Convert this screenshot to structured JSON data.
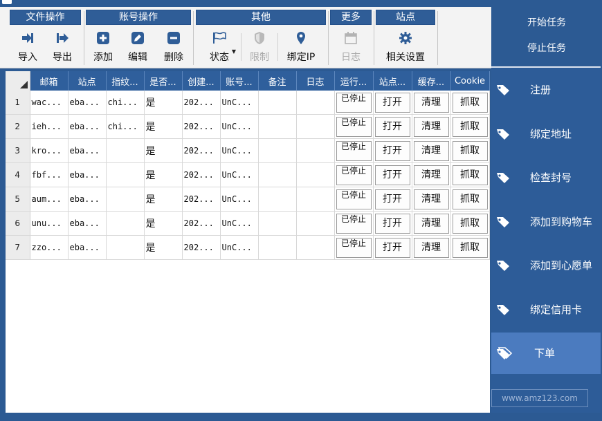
{
  "ribbon": {
    "groups": [
      {
        "title": "文件操作",
        "buttons": [
          {
            "label": "导入",
            "icon": "import-icon"
          },
          {
            "label": "导出",
            "icon": "export-icon"
          }
        ]
      },
      {
        "title": "账号操作",
        "buttons": [
          {
            "label": "添加",
            "icon": "plus-icon"
          },
          {
            "label": "编辑",
            "icon": "pencil-icon"
          },
          {
            "label": "删除",
            "icon": "minus-icon"
          }
        ]
      },
      {
        "title": "其他",
        "buttons": [
          {
            "label": "状态",
            "icon": "flag-icon"
          },
          {
            "label": "限制",
            "icon": "shield-icon"
          },
          {
            "label": "绑定IP",
            "icon": "location-pin-icon"
          }
        ]
      },
      {
        "title": "更多",
        "buttons": [
          {
            "label": "日志",
            "icon": "calendar-icon"
          }
        ]
      },
      {
        "title": "站点",
        "buttons": [
          {
            "label": "相关设置",
            "icon": "gear-icon"
          }
        ]
      }
    ]
  },
  "grid": {
    "columns": [
      "邮箱",
      "站点",
      "指纹...",
      "是否...",
      "创建...",
      "账号...",
      "备注",
      "日志",
      "运行...",
      "站点...",
      "缓存...",
      "Cookie"
    ],
    "rows": [
      {
        "num": "1",
        "email": "wac...",
        "site": "eba...",
        "fingerprint": "chi...",
        "flag": "是",
        "created": "202...",
        "account": "UnC...",
        "note": "",
        "log": "",
        "run": "已停止",
        "open": "打开",
        "clear": "清理",
        "fetch": "抓取"
      },
      {
        "num": "2",
        "email": "ieh...",
        "site": "eba...",
        "fingerprint": "chi...",
        "flag": "是",
        "created": "202...",
        "account": "UnC...",
        "note": "",
        "log": "",
        "run": "已停止",
        "open": "打开",
        "clear": "清理",
        "fetch": "抓取"
      },
      {
        "num": "3",
        "email": "kro...",
        "site": "eba...",
        "fingerprint": "",
        "flag": "是",
        "created": "202...",
        "account": "UnC...",
        "note": "",
        "log": "",
        "run": "已停止",
        "open": "打开",
        "clear": "清理",
        "fetch": "抓取"
      },
      {
        "num": "4",
        "email": "fbf...",
        "site": "eba...",
        "fingerprint": "",
        "flag": "是",
        "created": "202...",
        "account": "UnC...",
        "note": "",
        "log": "",
        "run": "已停止",
        "open": "打开",
        "clear": "清理",
        "fetch": "抓取"
      },
      {
        "num": "5",
        "email": "aum...",
        "site": "eba...",
        "fingerprint": "",
        "flag": "是",
        "created": "202...",
        "account": "UnC...",
        "note": "",
        "log": "",
        "run": "已停止",
        "open": "打开",
        "clear": "清理",
        "fetch": "抓取"
      },
      {
        "num": "6",
        "email": "unu...",
        "site": "eba...",
        "fingerprint": "",
        "flag": "是",
        "created": "202...",
        "account": "UnC...",
        "note": "",
        "log": "",
        "run": "已停止",
        "open": "打开",
        "clear": "清理",
        "fetch": "抓取"
      },
      {
        "num": "7",
        "email": "zzo...",
        "site": "eba...",
        "fingerprint": "",
        "flag": "是",
        "created": "202...",
        "account": "UnC...",
        "note": "",
        "log": "",
        "run": "已停止",
        "open": "打开",
        "clear": "清理",
        "fetch": "抓取"
      }
    ]
  },
  "sidebar": {
    "start_task": "开始任务",
    "stop_task": "停止任务",
    "items": [
      {
        "label": "注册",
        "icon": "tag-icon"
      },
      {
        "label": "绑定地址",
        "icon": "tag-icon"
      },
      {
        "label": "检查封号",
        "icon": "tag-icon"
      },
      {
        "label": "添加到购物车",
        "icon": "tag-icon"
      },
      {
        "label": "添加到心愿单",
        "icon": "tag-icon"
      },
      {
        "label": "绑定信用卡",
        "icon": "tag-icon"
      },
      {
        "label": "下单",
        "icon": "tags-icon"
      }
    ],
    "active_index": 6,
    "watermark": "www.amz123.com"
  },
  "colors": {
    "accent": "#2c5a93",
    "header": "#2f5f9c",
    "active": "#4b7bbf"
  }
}
